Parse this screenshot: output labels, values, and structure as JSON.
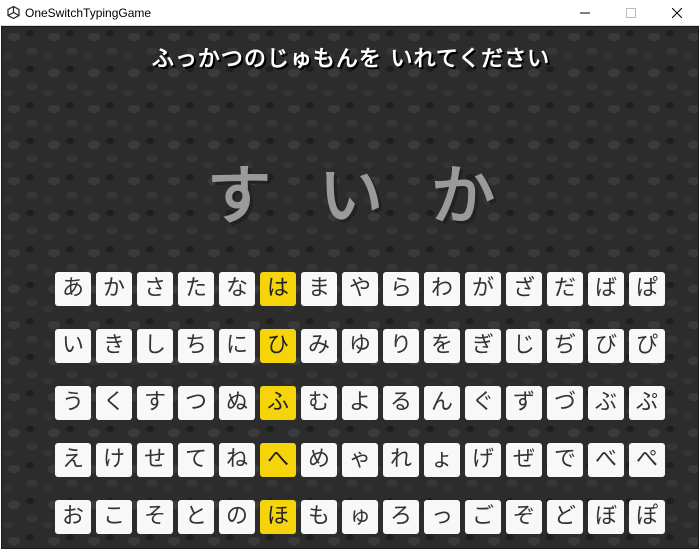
{
  "window": {
    "title": "OneSwitchTypingGame",
    "icon": "unity-icon",
    "controls": [
      "minimize",
      "maximize",
      "close"
    ]
  },
  "game": {
    "instruction": "ふっかつのじゅもんを いれてください",
    "answer": "すいか",
    "selected_column": 5,
    "selected_color": "#f5d50a",
    "keyboard": [
      [
        "あ",
        "か",
        "さ",
        "た",
        "な",
        "は",
        "ま",
        "や",
        "ら",
        "わ",
        "が",
        "ざ",
        "だ",
        "ば",
        "ぱ"
      ],
      [
        "い",
        "き",
        "し",
        "ち",
        "に",
        "ひ",
        "み",
        "ゆ",
        "り",
        "を",
        "ぎ",
        "じ",
        "ぢ",
        "び",
        "ぴ"
      ],
      [
        "う",
        "く",
        "す",
        "つ",
        "ぬ",
        "ふ",
        "む",
        "よ",
        "る",
        "ん",
        "ぐ",
        "ず",
        "づ",
        "ぶ",
        "ぷ"
      ],
      [
        "え",
        "け",
        "せ",
        "て",
        "ね",
        "へ",
        "め",
        "ゃ",
        "れ",
        "ょ",
        "げ",
        "ぜ",
        "で",
        "べ",
        "ぺ"
      ],
      [
        "お",
        "こ",
        "そ",
        "と",
        "の",
        "ほ",
        "も",
        "ゅ",
        "ろ",
        "っ",
        "ご",
        "ぞ",
        "ど",
        "ぼ",
        "ぽ"
      ]
    ]
  }
}
